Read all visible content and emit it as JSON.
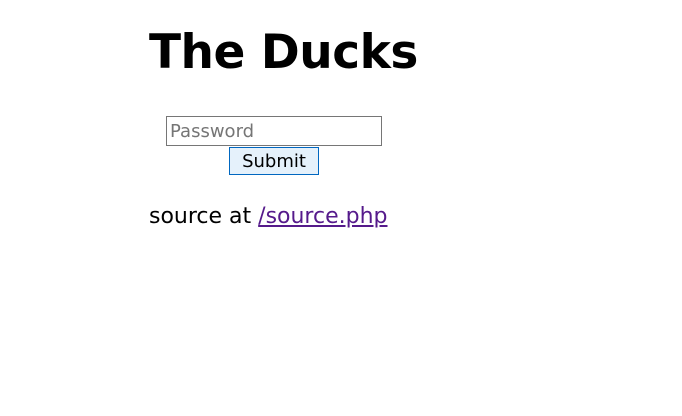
{
  "page": {
    "title": "The Ducks"
  },
  "login_form": {
    "password_placeholder": "Password",
    "password_value": "",
    "submit_label": "Submit"
  },
  "source_note": {
    "prefix": "source at ",
    "link_text": "/source.php"
  },
  "colors": {
    "link_visited": "#551a8b",
    "button_border": "#0067c0",
    "button_background": "#e5f1fb"
  }
}
